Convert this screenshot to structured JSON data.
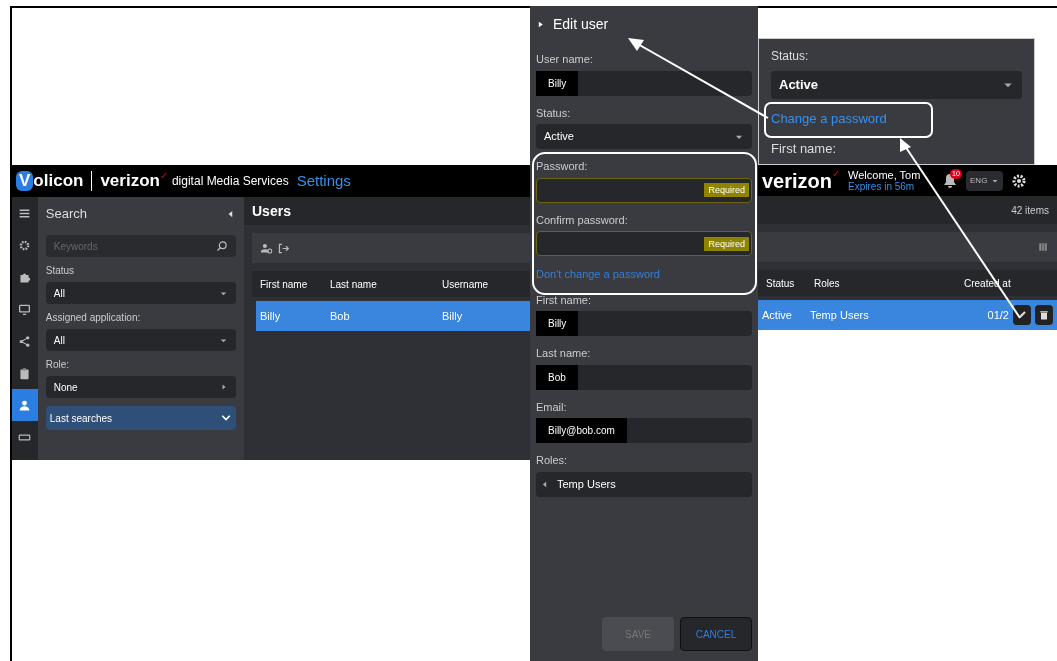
{
  "app_header": {
    "logo_initial": "V",
    "logo_rest": "olicon",
    "brand": "verizon",
    "brand_mark": "✓",
    "product": "digital Media Services",
    "section": "Settings",
    "brand_right": "verizon",
    "welcome": "Welcome, Tom",
    "expires": "Expires in 56m",
    "notification_count": "10",
    "language": "ENG"
  },
  "rail": [
    {
      "kind": "menu",
      "selected": false
    },
    {
      "kind": "gear",
      "selected": false
    },
    {
      "kind": "puzzle",
      "selected": false
    },
    {
      "kind": "monitor",
      "selected": false
    },
    {
      "kind": "share",
      "selected": false
    },
    {
      "kind": "clipboard",
      "selected": false
    },
    {
      "kind": "user",
      "selected": true
    },
    {
      "kind": "keyboard",
      "selected": false
    }
  ],
  "search_panel": {
    "title": "Search",
    "keywords_placeholder": "Keywords",
    "filters": [
      {
        "label": "Status",
        "value": "All",
        "kind": "dropdown"
      },
      {
        "label": "Assigned application:",
        "value": "All",
        "kind": "dropdown"
      },
      {
        "label": "Role:",
        "value": "None",
        "kind": "submenu"
      }
    ],
    "last_searches": "Last searches"
  },
  "users": {
    "title": "Users",
    "count": "42 items",
    "columns_left": [
      "First name",
      "Last name",
      "Username"
    ],
    "columns_right": [
      "Status",
      "Roles",
      "Created at"
    ],
    "rows": [
      {
        "selected": true,
        "cells_left": [
          "Billy",
          "Bob",
          "Billy"
        ],
        "cells_right": [
          "Active",
          "Temp Users",
          "01/2"
        ]
      }
    ]
  },
  "edit_user": {
    "title": "Edit user",
    "fields": [
      {
        "label": "User name:",
        "value": "Billy",
        "kind": "text"
      },
      {
        "label": "Status:",
        "value": "Active",
        "kind": "dropdown"
      },
      {
        "label": "Password:",
        "badge": "Required",
        "kind": "password"
      },
      {
        "label": "Confirm password:",
        "badge": "Required",
        "kind": "password"
      },
      {
        "link": "Don't change a password",
        "kind": "link"
      },
      {
        "label": "First name:",
        "value": "Billy",
        "kind": "text"
      },
      {
        "label": "Last name:",
        "value": "Bob",
        "kind": "text"
      },
      {
        "label": "Email:",
        "value": "Billy@bob.com",
        "kind": "text"
      },
      {
        "label": "Roles:",
        "value": "Temp Users",
        "kind": "roles"
      }
    ],
    "buttons": [
      {
        "label": "SAVE",
        "disabled": true
      },
      {
        "label": "CANCEL",
        "disabled": false
      }
    ]
  },
  "inset": {
    "status_label": "Status:",
    "status_value": "Active",
    "link": "Change a password",
    "next_label": "First name:"
  }
}
